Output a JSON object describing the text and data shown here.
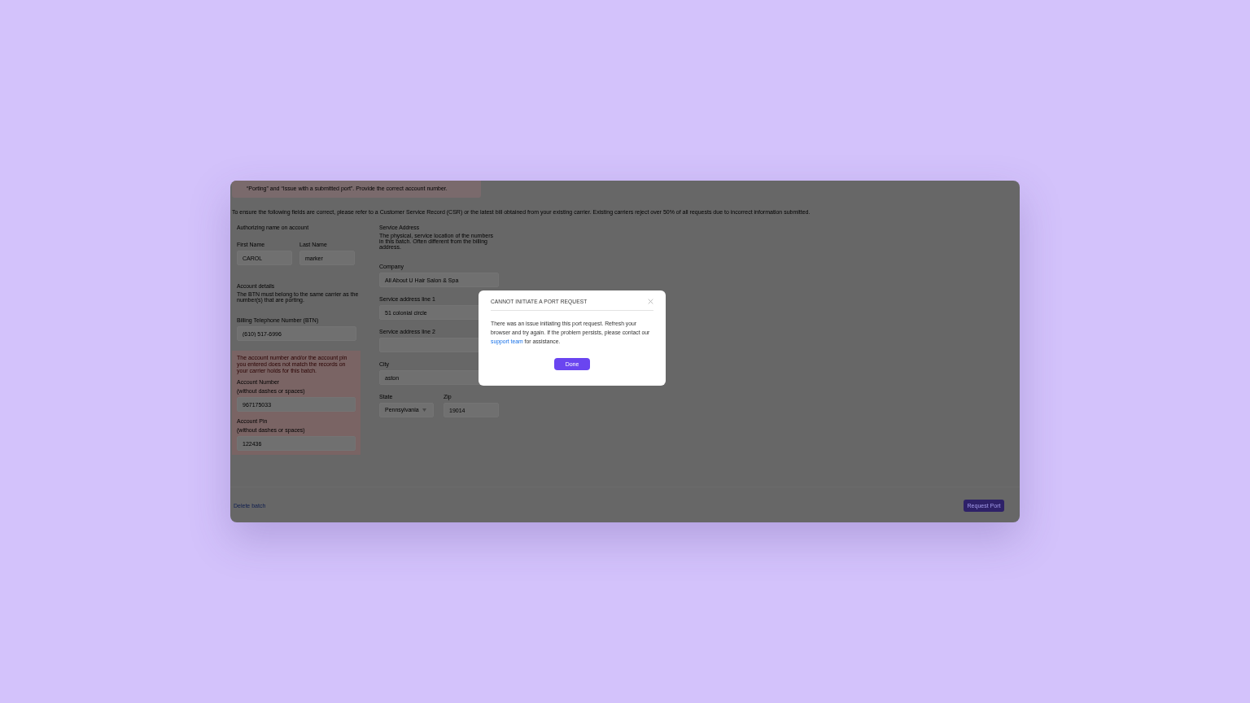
{
  "banner": {
    "text": "“Porting” and “Issue with a submitted port”. Provide the correct account number."
  },
  "intro": "To ensure the following fields are correct, please refer to a Customer Service Record (CSR) or the latest bill obtained from your existing carrier. Existing carriers reject over 50% of all requests due to incorrect information submitted.",
  "authorizing": {
    "heading": "Authorizing name on account",
    "fields": [
      {
        "label": "First Name",
        "value": "CAROL"
      },
      {
        "label": "Last Name",
        "value": "marker"
      }
    ]
  },
  "account_details": {
    "heading": "Account details",
    "description": "The BTN must belong to the same carrier as the number(s) that are porting.",
    "btn": {
      "label": "Billing Telephone Number (BTN)",
      "value": "(610) 517-6996"
    }
  },
  "account_error": {
    "message": "The account number and/or the account pin you entered does not match the records on your carrier holds for this batch.",
    "fields": [
      {
        "label": "Account Number",
        "hint": "(without dashes or spaces)",
        "value": "967175033"
      },
      {
        "label": "Account Pin",
        "hint": "(without dashes or spaces)",
        "value": "122436"
      }
    ]
  },
  "service_address": {
    "heading": "Service Address",
    "description": "The physical, service location of the numbers in this batch. Often different from the billing address.",
    "fields": [
      {
        "label": "Company",
        "value": "All About U Hair Salon & Spa"
      },
      {
        "label": "Service address line 1",
        "value": "51 colonial circle"
      },
      {
        "label": "Service address line 2"
      },
      {
        "label": "City",
        "value": "aston"
      }
    ],
    "state": {
      "label": "State",
      "value": "Pennsylvania"
    },
    "zip": {
      "label": "Zip",
      "value": "19014"
    }
  },
  "footer": {
    "delete_link": "Delete batch",
    "request_button": "Request Port"
  },
  "dialog": {
    "title": "CANNOT INITIATE A PORT REQUEST",
    "message_start": "There was an issue initiating this port request. Refresh your browser and try again. If the problem persists, please contact our",
    "link": "support team",
    "message_end": "for assistance.",
    "done_button": "Done"
  }
}
